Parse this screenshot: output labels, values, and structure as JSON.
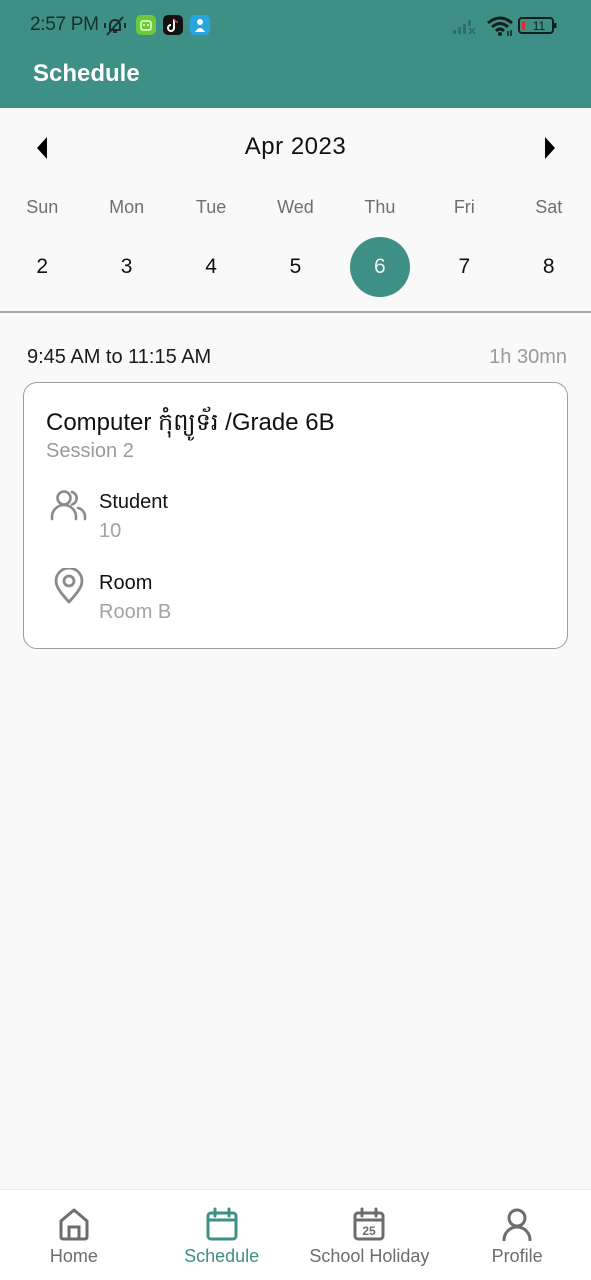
{
  "status_bar": {
    "time": "2:57 PM",
    "battery_level": "11",
    "icons": [
      "notifications-muted-icon",
      "app-green-icon",
      "tiktok-icon",
      "app-blue-icon",
      "signal-none-icon",
      "wifi-icon",
      "battery-icon"
    ]
  },
  "header": {
    "title": "Schedule"
  },
  "calendar": {
    "month_label": "Apr 2023",
    "prev_icon": "triangle-left-icon",
    "next_icon": "triangle-right-icon",
    "weekdays": [
      "Sun",
      "Mon",
      "Tue",
      "Wed",
      "Thu",
      "Fri",
      "Sat"
    ],
    "days": [
      "2",
      "3",
      "4",
      "5",
      "6",
      "7",
      "8"
    ],
    "selected_day": "6",
    "accent_color": "#3e8f85"
  },
  "session": {
    "time_range": "9:45 AM to 11:15 AM",
    "duration": "1h 30mn",
    "title": "Computer កុំព្យូទ័រ /Grade 6B",
    "subtitle": "Session 2",
    "student_label": "Student",
    "student_value": "10",
    "room_label": "Room",
    "room_value": "Room B"
  },
  "bottom_nav": {
    "items": [
      {
        "label": "Home",
        "icon": "home-icon",
        "active": false
      },
      {
        "label": "Schedule",
        "icon": "calendar-icon",
        "active": true
      },
      {
        "label": "School Holiday",
        "icon": "calendar-25-icon",
        "active": false
      },
      {
        "label": "Profile",
        "icon": "person-icon",
        "active": false
      }
    ]
  }
}
